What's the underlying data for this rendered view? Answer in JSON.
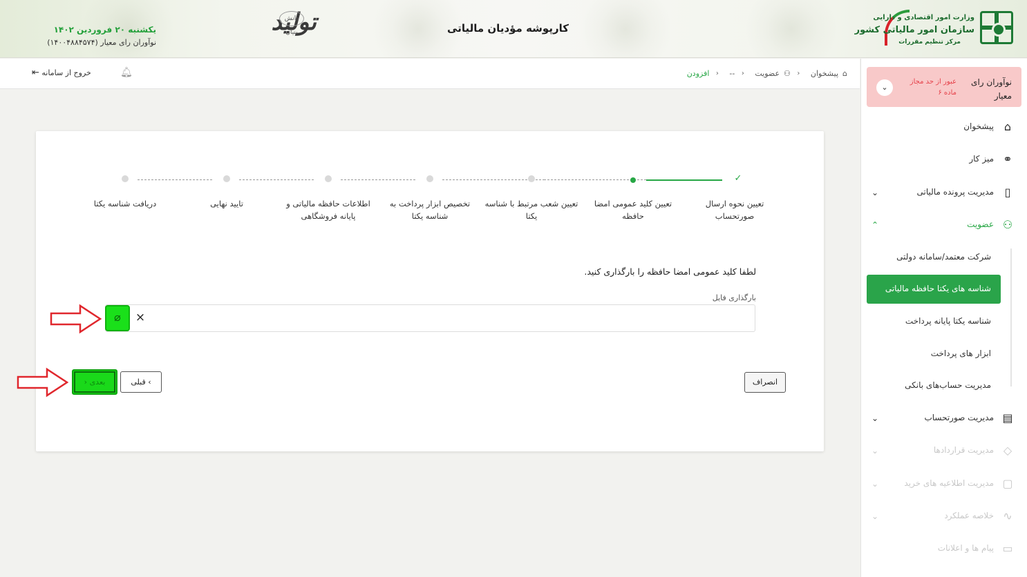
{
  "header": {
    "app_title": "کارپوشه مؤدیان مالیاتی",
    "org_line1": "وزارت امور اقتصادی و دارایی",
    "org_line2": "سازمان امور مالیاتی کشور",
    "org_line3": "مرکز تنظیم مقررات",
    "calligraphy": "تولید",
    "calligraphy_small": "دانش بنیان",
    "date": "یکشنبه ۲۰ فروردین ۱۴۰۲",
    "user": "نوآوران رای معیار (۱۴۰۰۴۸۸۴۵۷۴)"
  },
  "topbar": {
    "breadcrumb": [
      "پیشخوان",
      "عضویت",
      "--",
      "افزودن"
    ],
    "logout_label": "خروج از سامانه"
  },
  "sidebar": {
    "alert": {
      "name": "نوآوران رای معیار",
      "warning": "عبور از حد مجاز ماده ۶"
    },
    "items": [
      {
        "label": "پیشخوان",
        "icon": "home-icon"
      },
      {
        "label": "میز کار",
        "icon": "workdesk-icon"
      },
      {
        "label": "مدیریت پرونده مالیاتی",
        "icon": "file-icon"
      },
      {
        "label": "عضویت",
        "icon": "user-icon"
      },
      {
        "label": "مدیریت صورتحساب",
        "icon": "invoice-icon"
      },
      {
        "label": "مدیریت قراردادها",
        "icon": "handshake-icon"
      },
      {
        "label": "مدیریت اطلاعیه های خرید",
        "icon": "clipboard-icon"
      },
      {
        "label": "خلاصه عملکرد",
        "icon": "chart-icon"
      },
      {
        "label": "پیام ها و اعلانات",
        "icon": "message-icon"
      }
    ],
    "subitems": [
      {
        "label": "شرکت معتمد/سامانه دولتی"
      },
      {
        "label": "شناسه های یکتا حافظه مالیاتی"
      },
      {
        "label": "شناسه یکتا پایانه پرداخت"
      },
      {
        "label": "ابزار های پرداخت"
      },
      {
        "label": "مدیریت حساب‌های بانکی"
      }
    ]
  },
  "stepper": {
    "steps": [
      {
        "label": "تعیین نحوه ارسال صورتحساب",
        "state": "done"
      },
      {
        "label": "تعیین کلید عمومی امضا حافظه",
        "state": "current"
      },
      {
        "label": "تعیین شعب مرتبط با شناسه یکتا",
        "state": "pending"
      },
      {
        "label": "تخصیص ابزار پرداخت به شناسه یکتا",
        "state": "pending"
      },
      {
        "label": "اطلاعات حافظه مالیاتی و پایانه فروشگاهی",
        "state": "pending"
      },
      {
        "label": "تایید نهایی",
        "state": "pending"
      },
      {
        "label": "دریافت شناسه یکتا",
        "state": "pending"
      }
    ]
  },
  "form": {
    "prompt": "لطفا کلید عمومی امضا حافظه را بارگذاری کنید.",
    "upload_label": "بارگذاری فایل",
    "cancel_label": "انصراف",
    "prev_label": "قبلی",
    "next_label": "بعدی"
  },
  "colors": {
    "accent": "#27a745",
    "highlight_green": "#1ae01a",
    "alert_bg": "#f8c9c9",
    "arrow_red": "#e0272d"
  }
}
